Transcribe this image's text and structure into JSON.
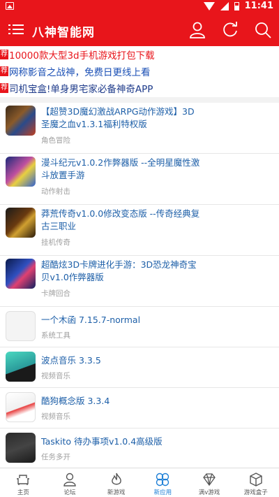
{
  "status": {
    "time": "11:41"
  },
  "header": {
    "title": "八神智能网"
  },
  "notices": [
    {
      "tag": "荐",
      "text": "10000款大型3d手机游戏打包下载"
    },
    {
      "tag": "荐",
      "text": "网称影音之战神，免费日更线上看"
    },
    {
      "tag": "荐",
      "text": "司机宝盒!单身男宅家必备神奇APP"
    }
  ],
  "items": [
    {
      "name": "【超赞3D魔幻激战ARPG动作游戏】3D圣魔之血v1.3.1福利特权版",
      "category": "角色冒险"
    },
    {
      "name": "漫斗纪元v1.0.2作弊器版 --全明星魔性激斗放置手游",
      "category": "动作射击"
    },
    {
      "name": "莽荒传奇v1.0.0修改变态版 --传奇经典复古三职业",
      "category": "挂机传奇"
    },
    {
      "name": "超酷炫3D卡牌进化手游：3D恐龙神奇宝贝v1.0作弊器版",
      "category": "卡牌回合"
    },
    {
      "name": "一个木函 7.15.7-normal",
      "category": "系统工具"
    },
    {
      "name": "波点音乐 3.3.5",
      "category": "视频音乐"
    },
    {
      "name": "酷狗概念版 3.3.4",
      "category": "视频音乐"
    },
    {
      "name": "Taskito 待办事项v1.0.4高级版",
      "category": "任务多开"
    }
  ],
  "tabs": [
    {
      "label": "主页",
      "icon": "sofa-icon"
    },
    {
      "label": "论坛",
      "icon": "user-icon"
    },
    {
      "label": "新游戏",
      "icon": "flame-icon"
    },
    {
      "label": "新应用",
      "icon": "flower-icon"
    },
    {
      "label": "满v游戏",
      "icon": "diamond-icon"
    },
    {
      "label": "游戏盒子",
      "icon": "box-icon"
    }
  ],
  "colors": {
    "brand": "#e8151b",
    "link": "#1d5fa8",
    "active_tab": "#1d7fd6"
  }
}
